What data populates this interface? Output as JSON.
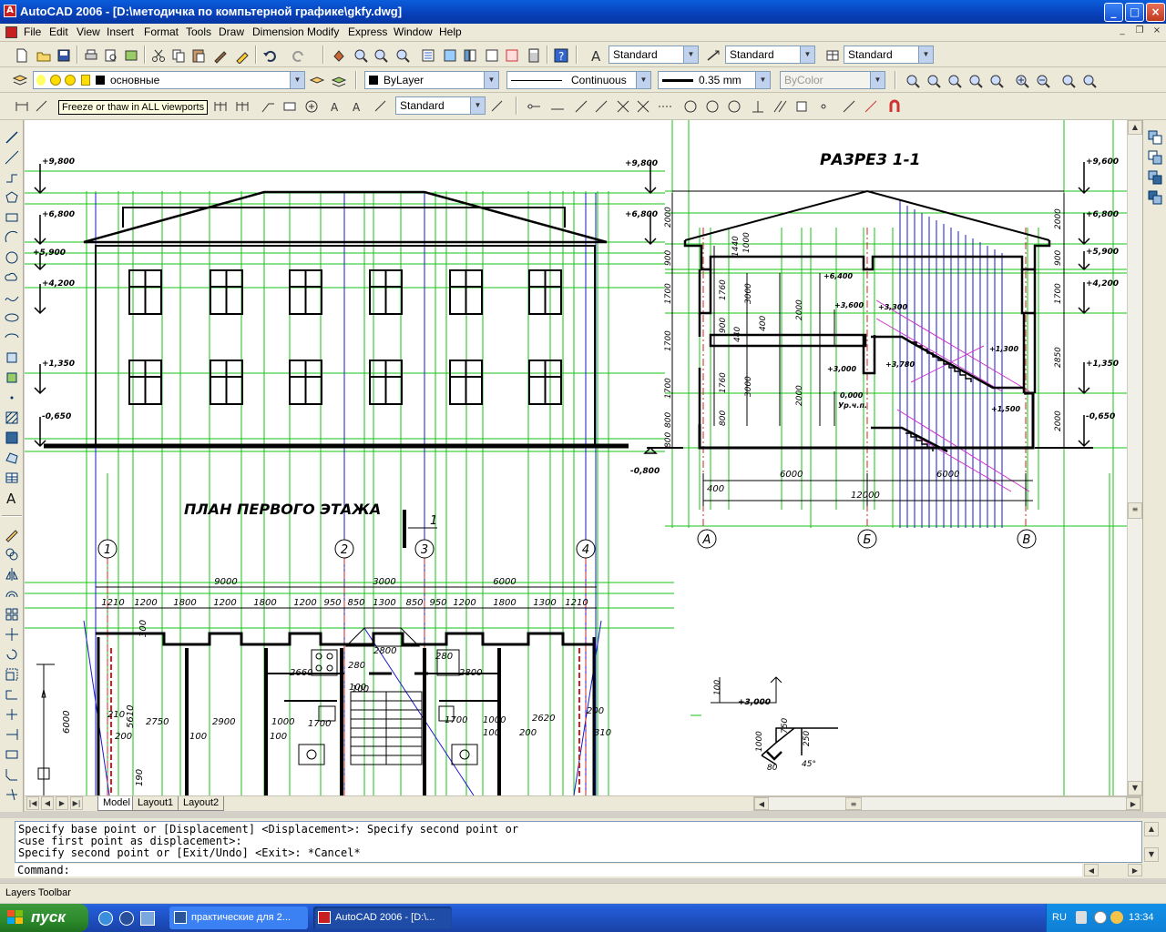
{
  "window": {
    "title": "AutoCAD 2006 - [D:\\методичка по компьтерной графике\\gkfy.dwg]",
    "app_icon": "autocad-icon"
  },
  "menu": [
    "File",
    "Edit",
    "View",
    "Insert",
    "Format",
    "Tools",
    "Draw",
    "Dimension",
    "Modify",
    "Express",
    "Window",
    "Help"
  ],
  "styles_toolbar": {
    "text_style": "Standard",
    "dim_style": "Standard",
    "table_style": "Standard"
  },
  "layers_toolbar": {
    "current_layer": "основные",
    "color": "ByLayer",
    "linetype": "Continuous",
    "lineweight": "0.35 mm",
    "plot_style": "ByColor"
  },
  "dimension_toolbar": {
    "dim_style": "Standard"
  },
  "tooltip": "Freeze or thaw in ALL viewports",
  "drawing": {
    "section_title": "РАЗРЕЗ 1-1",
    "plan_title": "ПЛАН ПЕРВОГО ЭТАЖА",
    "section_mark": "1",
    "facade_levels": [
      "+9,800",
      "+6,800",
      "+5,900",
      "+4,200",
      "+1,350",
      "-0,650"
    ],
    "section_left_levels": [
      "+9,800",
      "+6,800",
      "-0,800"
    ],
    "section_right_levels": [
      "+9,600",
      "+6,800",
      "+5,900",
      "+4,200",
      "+1,350",
      "-0,650"
    ],
    "section_inner_levels": [
      "+6,400",
      "+3,600",
      "+3,300",
      "+3,000",
      "+3,780",
      "+1,300",
      "+1,500",
      "0,000",
      "Ур.ч.п."
    ],
    "section_vert_dims_left": [
      "2000",
      "900",
      "1700",
      "1700",
      "1700",
      "800",
      "800"
    ],
    "section_vert_dims_inner": [
      "1440",
      "1000",
      "1760",
      "3000",
      "900",
      "400",
      "440",
      "2000",
      "1760",
      "3000",
      "800",
      "2000"
    ],
    "section_vert_dims_right": [
      "2000",
      "900",
      "1700",
      "2850",
      "2000"
    ],
    "section_horiz_dims": [
      "6000",
      "6000",
      "400",
      "12000"
    ],
    "section_axes": [
      "А",
      "Б",
      "В"
    ],
    "plan_axes": [
      "1",
      "2",
      "3",
      "4"
    ],
    "plan_top_dims_major": [
      "9000",
      "3000",
      "6000"
    ],
    "plan_top_dims_minor": [
      "1210",
      "1200",
      "1800",
      "1200",
      "1800",
      "1200",
      "950",
      "850",
      "1300",
      "850",
      "950",
      "1200",
      "1800",
      "1300",
      "1210"
    ],
    "plan_inner_dims": [
      "2800",
      "280",
      "2800",
      "2660",
      "100",
      "280",
      "300",
      "2750",
      "2900",
      "1000",
      "1700",
      "100",
      "1700",
      "1000",
      "100",
      "2620",
      "210",
      "5610",
      "200",
      "100",
      "200",
      "310",
      "6000",
      "190",
      "200",
      "100"
    ],
    "detail1_dims": [
      "100",
      "+3,000"
    ],
    "detail2_dims": [
      "750",
      "250",
      "1000",
      "80",
      "45°"
    ]
  },
  "layout_tabs": [
    "Model",
    "Layout1",
    "Layout2"
  ],
  "command_history": [
    "Specify base point or [Displacement] <Displacement>: Specify second point or",
    "<use first point as displacement>:",
    "Specify second point or [Exit/Undo] <Exit>: *Cancel*"
  ],
  "command_prompt": "Command:",
  "statusbar": {
    "text": "Layers Toolbar"
  },
  "taskbar": {
    "start_label": "пуск",
    "tasks": [
      "практические для 2...",
      "AutoCAD 2006 - [D:\\..."
    ],
    "language": "RU",
    "clock": "13:34"
  }
}
